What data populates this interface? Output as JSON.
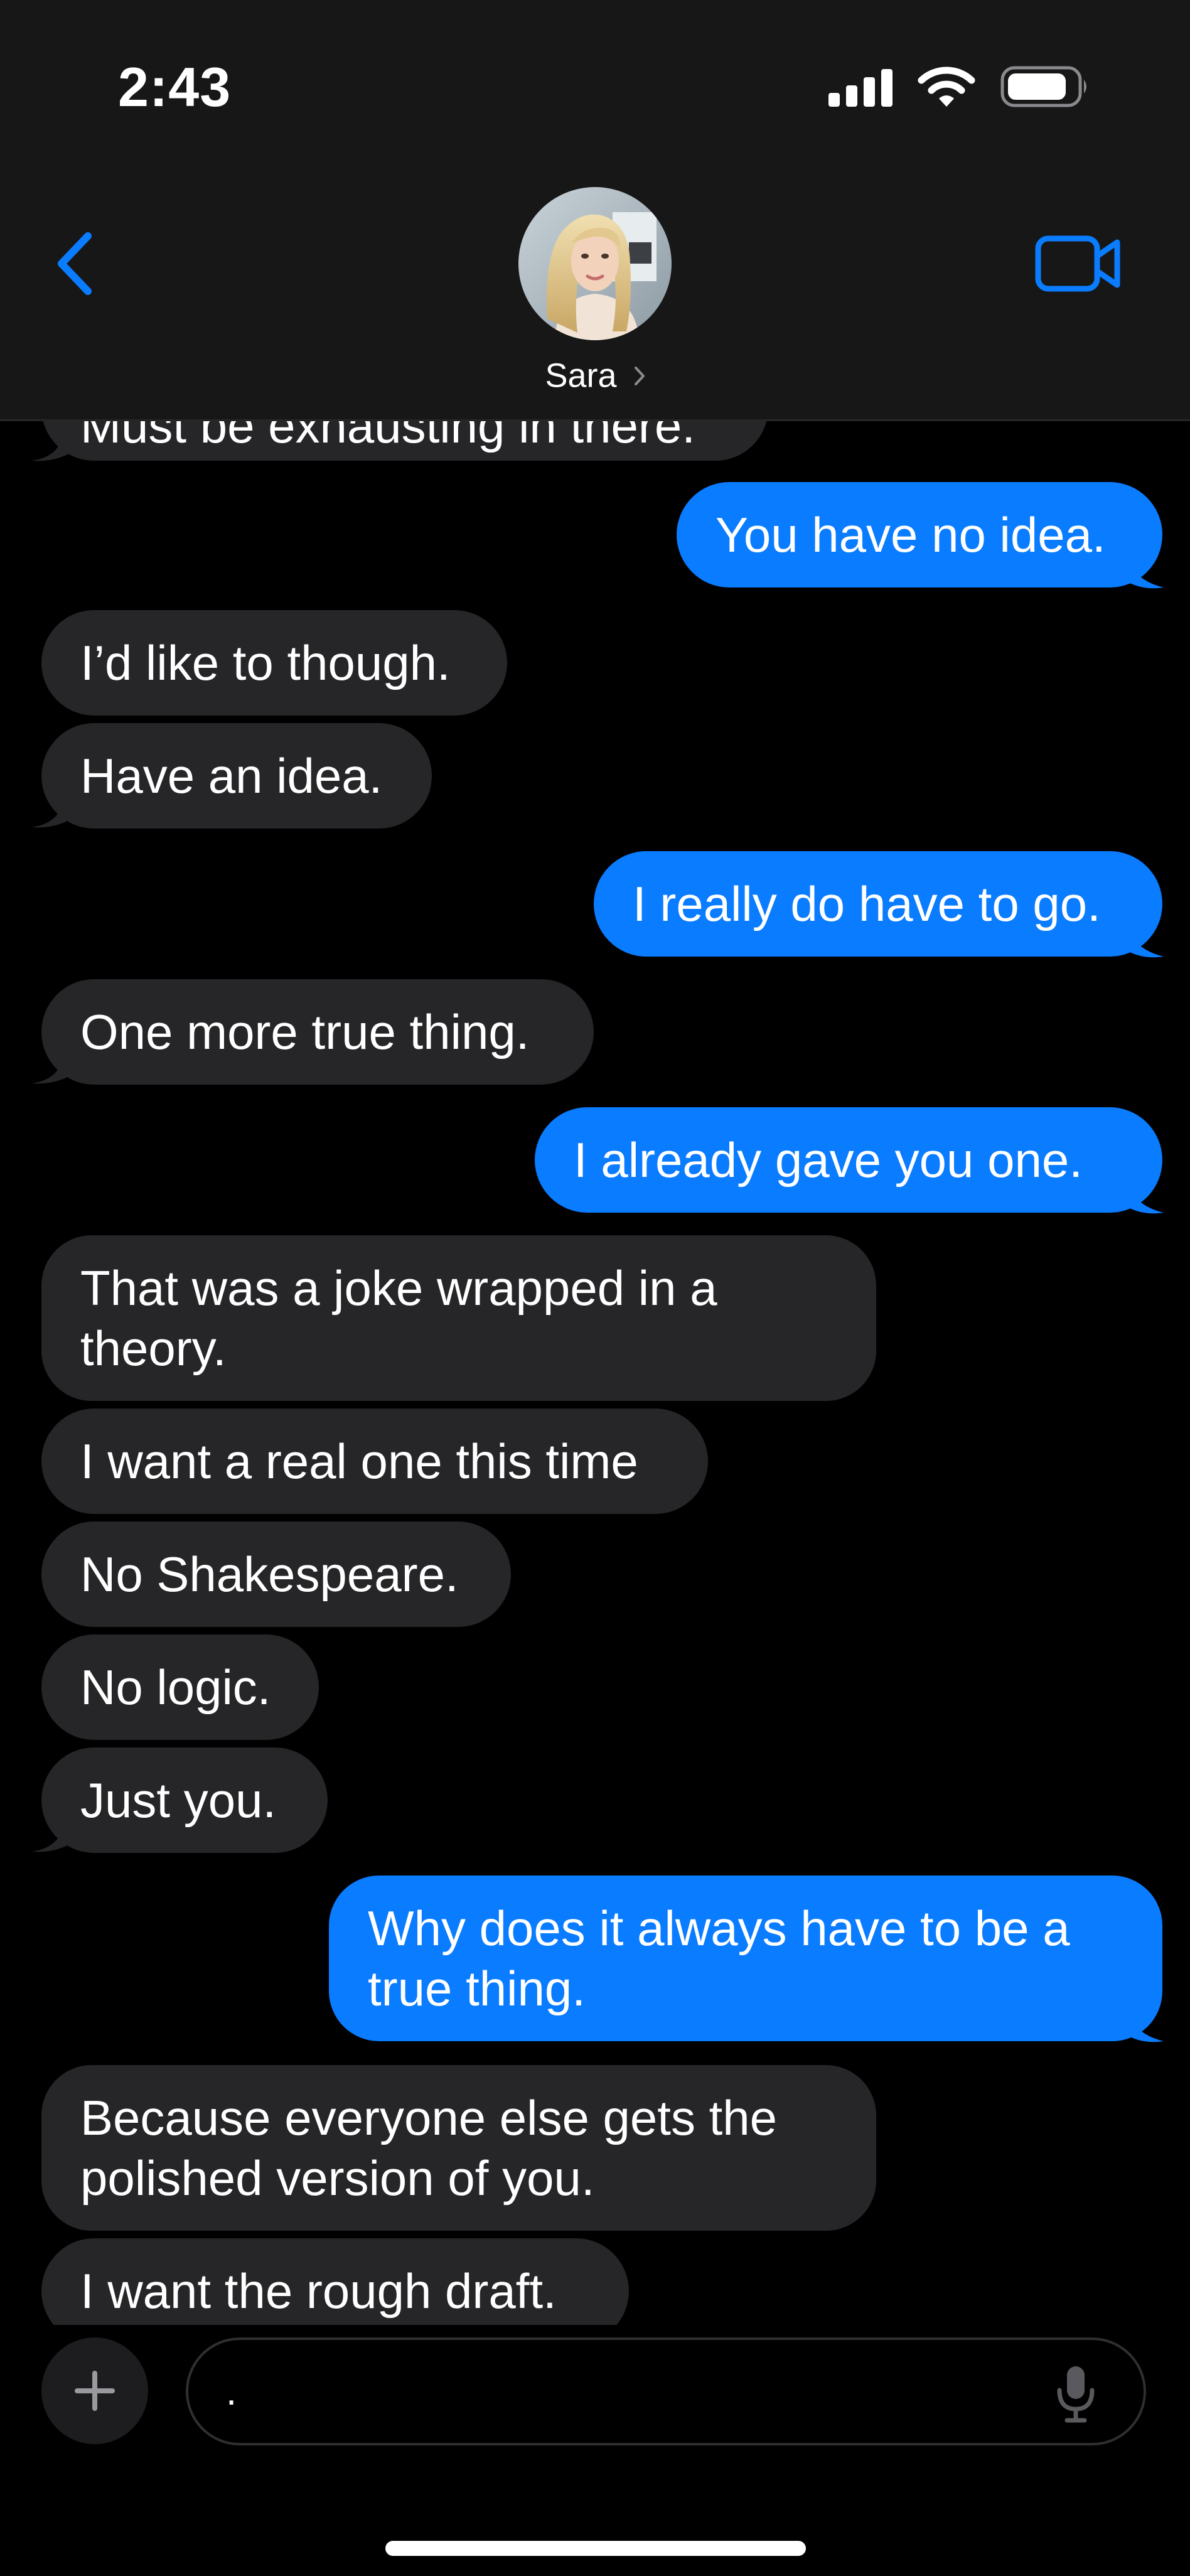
{
  "status_bar": {
    "time": "2:43",
    "icons": [
      "cellular-signal-icon",
      "wifi-icon",
      "battery-icon"
    ]
  },
  "header": {
    "back_icon": "chevron-left-icon",
    "contact_name": "Sara",
    "name_chevron_icon": "chevron-right-icon",
    "video_icon": "video-camera-icon"
  },
  "colors": {
    "background": "#000000",
    "header_background": "#171717",
    "incoming_bubble": "#262628",
    "outgoing_bubble": "#0a7cff",
    "accent": "#0a7cff"
  },
  "messages": [
    {
      "direction": "in",
      "text": "Must be exhausting in there."
    },
    {
      "direction": "out",
      "text": "You have no idea."
    },
    {
      "direction": "in",
      "text": "I’d like to though."
    },
    {
      "direction": "in",
      "text": "Have an idea."
    },
    {
      "direction": "out",
      "text": "I really do have to go."
    },
    {
      "direction": "in",
      "text": "One more true thing."
    },
    {
      "direction": "out",
      "text": "I already gave you one."
    },
    {
      "direction": "in",
      "text": "That was a joke wrapped in a theory."
    },
    {
      "direction": "in",
      "text": "I want a real one this time"
    },
    {
      "direction": "in",
      "text": "No Shakespeare."
    },
    {
      "direction": "in",
      "text": "No logic."
    },
    {
      "direction": "in",
      "text": "Just you."
    },
    {
      "direction": "out",
      "text": "Why does it always have to be a true thing."
    },
    {
      "direction": "in",
      "text": "Because everyone else gets the polished version of you."
    },
    {
      "direction": "in",
      "text": "I want the rough draft."
    }
  ],
  "composer": {
    "plus_icon": "plus-icon",
    "value": ".",
    "mic_icon": "microphone-icon"
  }
}
